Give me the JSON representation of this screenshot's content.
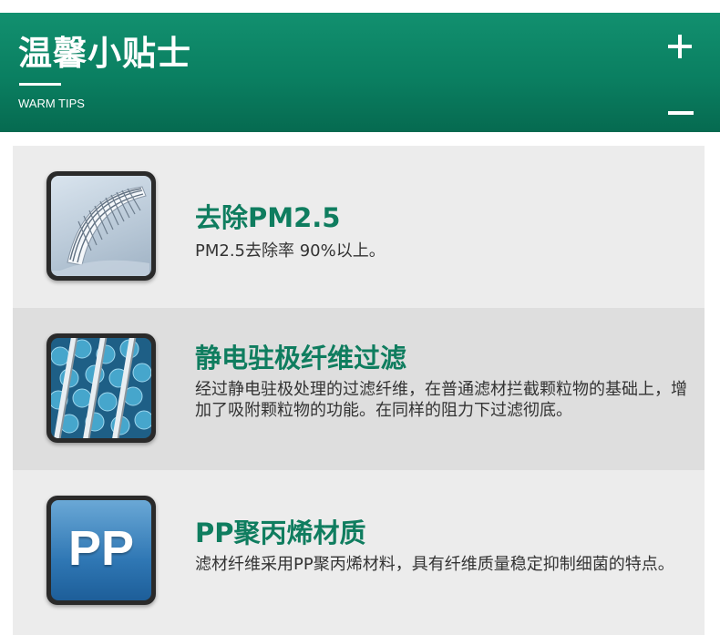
{
  "header": {
    "title": "温馨小贴士",
    "subtitle": "WARM TIPS",
    "expand_icon": "plus-icon",
    "collapse_icon": "minus-icon",
    "color": "#0a7f61"
  },
  "tips": [
    {
      "icon": "filter-mesh-icon",
      "title": "去除PM2.5",
      "description": "PM2.5去除率 90%以上。"
    },
    {
      "icon": "electrostatic-fiber-icon",
      "title": "静电驻极纤维过滤",
      "description": "经过静电驻极处理的过滤纤维，在普通滤材拦截颗粒物的基础上，增加了吸附颗粒物的功能。在同样的阻力下过滤彻底。"
    },
    {
      "icon": "pp-material-icon",
      "icon_text": "PP",
      "title": "PP聚丙烯材质",
      "description": "滤材纤维采用PP聚丙烯材料，具有纤维质量稳定抑制细菌的特点。"
    }
  ],
  "colors": {
    "title": "#0f7d5f",
    "panel_light": "#ececec",
    "panel_dark": "#dedede"
  }
}
